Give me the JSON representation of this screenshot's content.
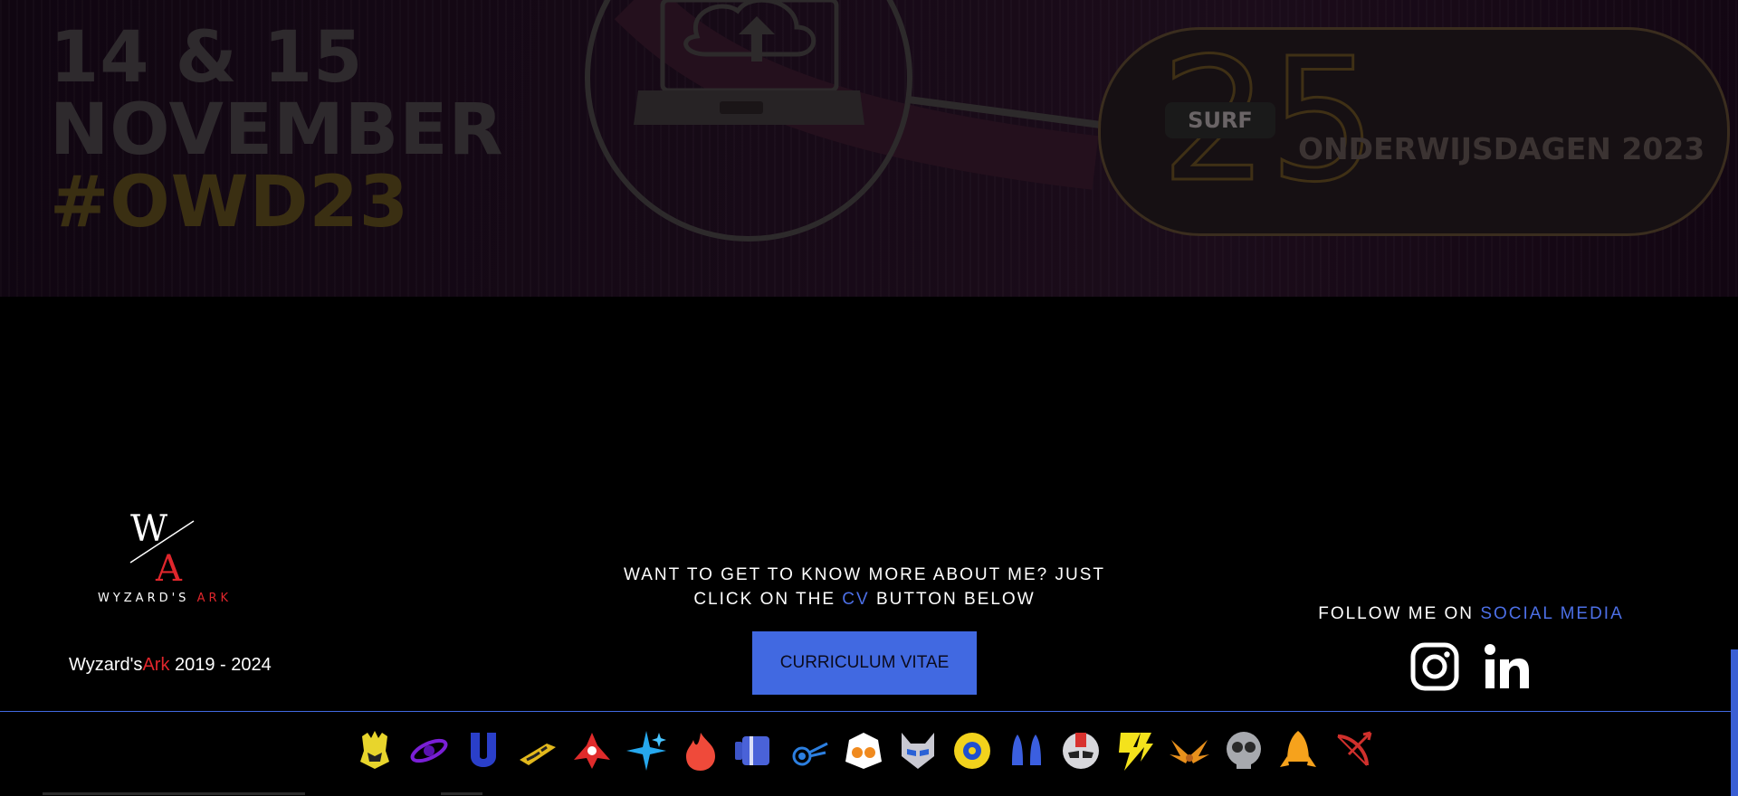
{
  "banner": {
    "date_line1": "14 & 15",
    "date_line2": "NOVEMBER",
    "hashtag": "#OWD23",
    "surf_tag": "SURF",
    "anniversary": "25",
    "event_name": "ONDERWIJSDAGEN 2023"
  },
  "footer": {
    "logo": {
      "monogram_top": "W",
      "monogram_bottom": "A",
      "wordmark_main": "WYZARD'S",
      "wordmark_accent": "ARK"
    },
    "copyright": {
      "name_main": "Wyzard's",
      "name_accent": "Ark",
      "years": " 2019 - 2024"
    },
    "cv": {
      "text_line1": "WANT TO GET TO KNOW MORE ABOUT ME? JUST",
      "text_line2_pre": "CLICK ON THE ",
      "text_line2_accent": "CV",
      "text_line2_post": " BUTTON BELOW",
      "button_label": "CURRICULUM VITAE"
    },
    "social": {
      "text_pre": "FOLLOW ME ON ",
      "text_accent": "SOCIAL MEDIA",
      "icons": [
        "instagram-icon",
        "linkedin-icon"
      ]
    },
    "icon_strip": [
      "yellow-crest-icon",
      "purple-orbit-icon",
      "blue-magnet-icon",
      "yellow-stripes-icon",
      "red-crane-icon",
      "blue-sparkle-icon",
      "red-flame-icon",
      "blue-cylinder-icon",
      "blue-swirl-icon",
      "orange-mask-icon",
      "blue-horned-mask-icon",
      "yellow-gear-icon",
      "blue-rockets-icon",
      "red-helmet-icon",
      "yellow-lightning-icon",
      "orange-wings-icon",
      "grey-skull-icon",
      "orange-rocket-icon",
      "red-bow-icon"
    ]
  },
  "colors": {
    "accent_blue": "#4169e1",
    "accent_red": "#e0262c",
    "background": "#000000"
  }
}
